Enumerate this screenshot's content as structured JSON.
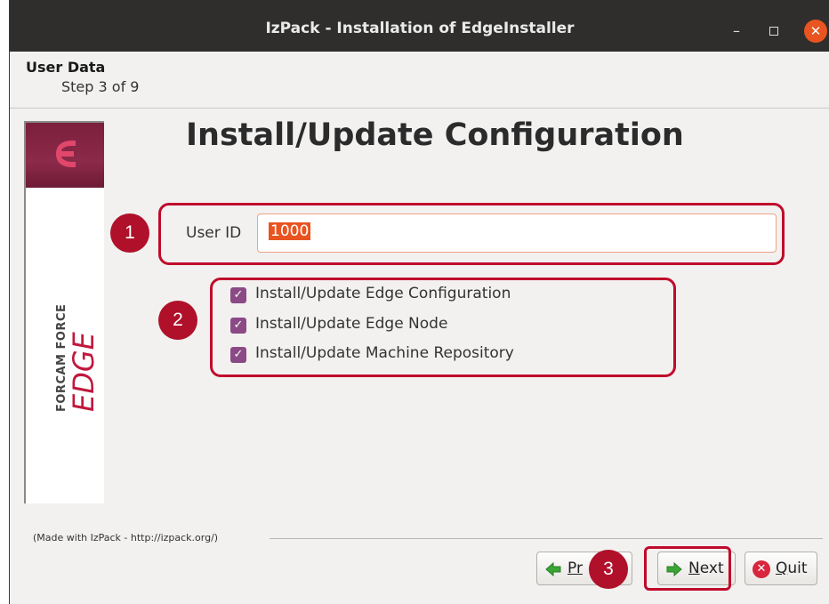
{
  "window": {
    "title": "IzPack - Installation of  EdgeInstaller",
    "controls": {
      "minimize": "–",
      "close": "✕"
    }
  },
  "header": {
    "panel_title": "User Data",
    "step": "Step 3 of 9"
  },
  "banner": {
    "logo_icon": "edge-logo-icon",
    "brand_line1": "FORCAM FORCE",
    "brand_line2": "EDGE",
    "colors": {
      "banner_top": "#7a1f3c",
      "brand_red": "#c0183c"
    }
  },
  "main": {
    "heading": "Install/Update Configuration",
    "user_id": {
      "label": "User ID",
      "value": "1000"
    },
    "options": [
      {
        "label": "Install/Update Edge Configuration",
        "checked": true
      },
      {
        "label": "Install/Update Edge Node",
        "checked": true
      },
      {
        "label": "Install/Update Machine Repository",
        "checked": true
      }
    ]
  },
  "footer": {
    "made_with": "(Made with IzPack - http://izpack.org/)",
    "buttons": {
      "previous": {
        "label_prefix": "Pr",
        "label_suffix": "s",
        "icon": "arrow-left-icon"
      },
      "next": {
        "label_underlined": "N",
        "label_rest": "ext",
        "icon": "arrow-right-icon"
      },
      "quit": {
        "label_underlined": "Q",
        "label_rest": "uit",
        "icon": "close-circle-icon"
      }
    }
  },
  "annotations": {
    "marker1": "1",
    "marker2": "2",
    "marker3": "3",
    "color": "#c00b2b"
  },
  "colors": {
    "accent": "#e95420",
    "checkbox": "#8b4a85",
    "titlebar": "#2f2e2c"
  }
}
